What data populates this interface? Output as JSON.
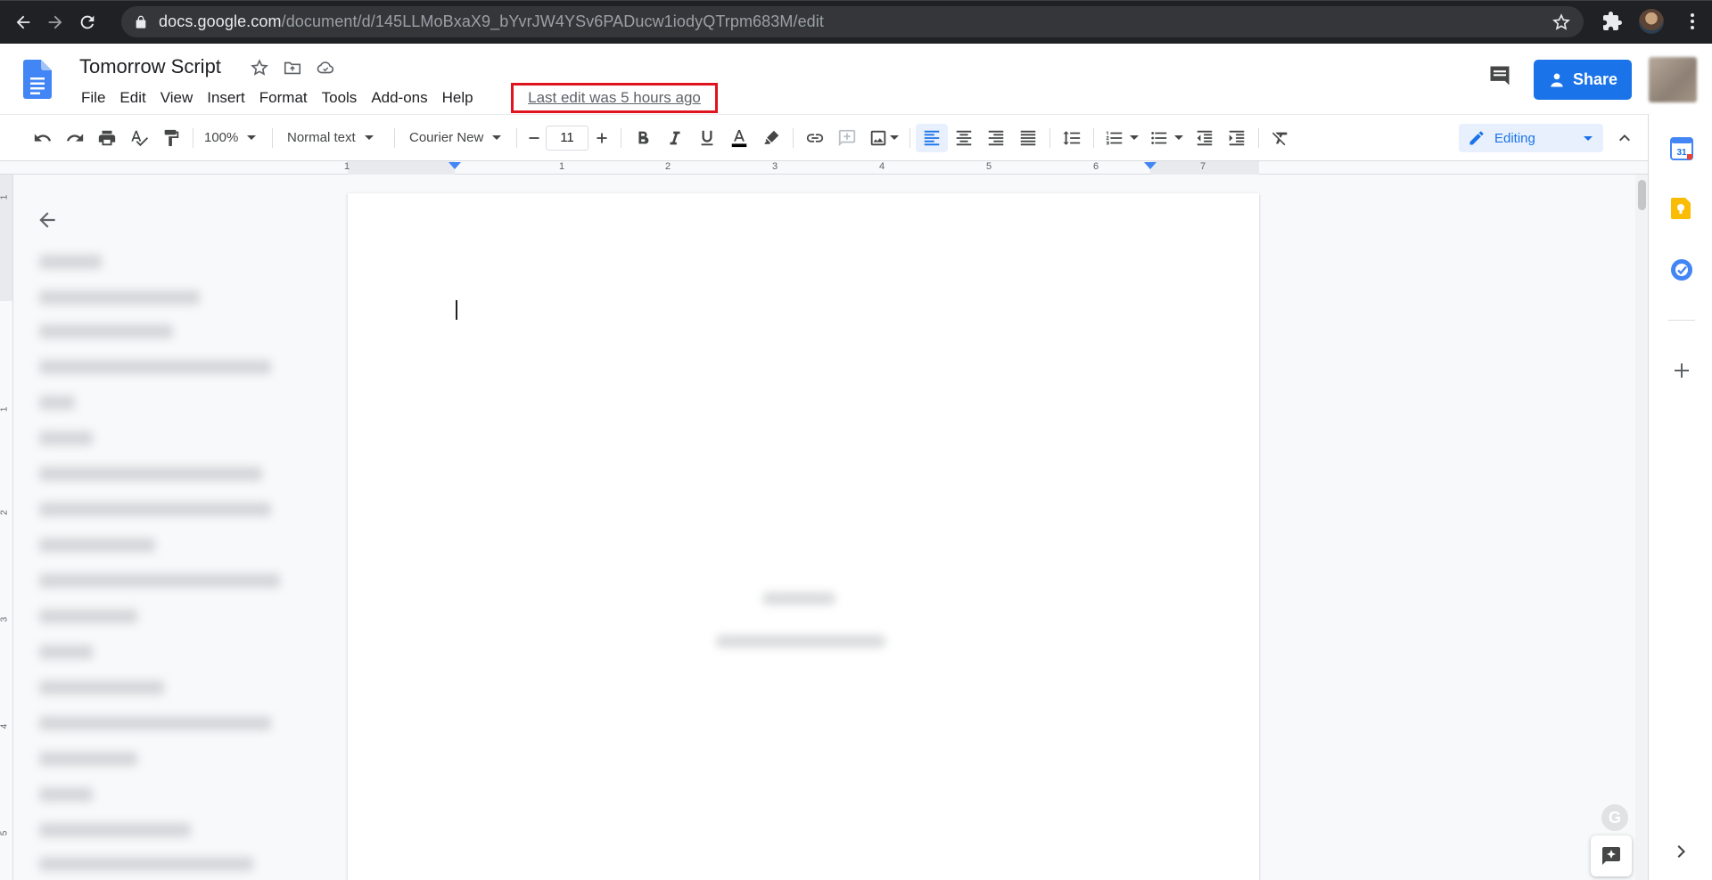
{
  "browser": {
    "url_host": "docs.google.com",
    "url_path": "/document/d/145LLMoBxaX9_bYvrJW4YSv6PADucw1iodyQTrpm683M/edit"
  },
  "docs": {
    "title": "Tomorrow Script",
    "menu": [
      "File",
      "Edit",
      "View",
      "Insert",
      "Format",
      "Tools",
      "Add-ons",
      "Help"
    ],
    "last_edit": "Last edit was 5 hours ago",
    "share_label": "Share"
  },
  "toolbar": {
    "zoom": "100%",
    "style": "Normal text",
    "font": "Courier New",
    "font_size": "11",
    "mode": "Editing"
  },
  "ruler": {
    "h_labels": [
      "1",
      "1",
      "1",
      "2",
      "3",
      "4",
      "5",
      "6",
      "7"
    ],
    "v_labels": [
      "1",
      "1",
      "2",
      "3",
      "4",
      "5"
    ]
  },
  "side_panel": {
    "calendar_day": "31"
  },
  "colors": {
    "accent": "#1a73e8",
    "highlight_box": "#e0141e",
    "chrome_bg": "#202124"
  }
}
